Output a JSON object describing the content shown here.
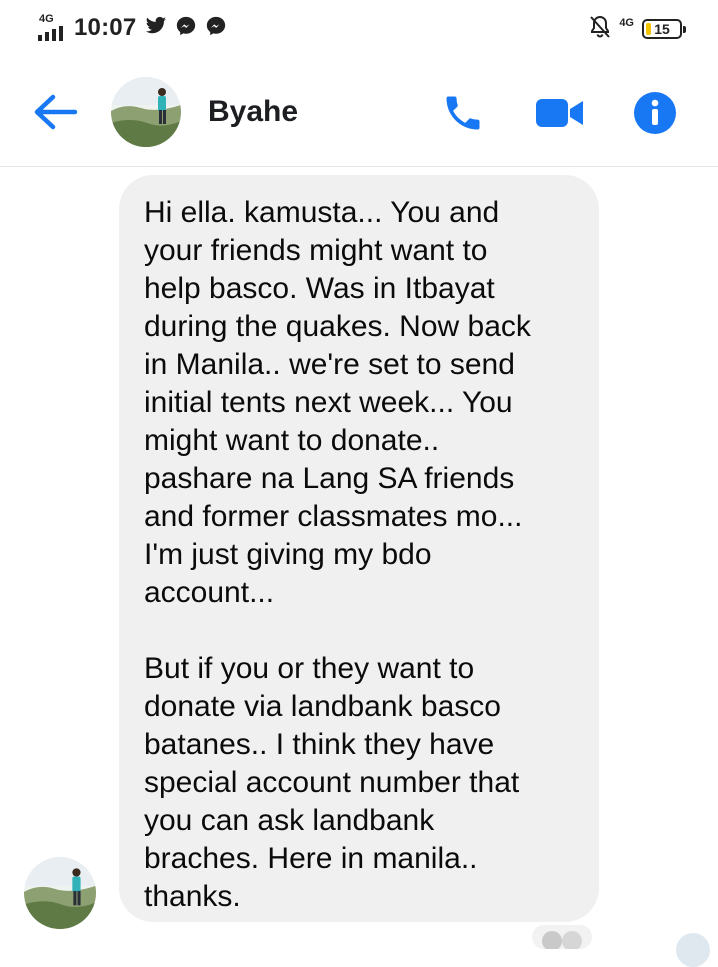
{
  "status_bar": {
    "network_left": "4G",
    "time": "10:07",
    "network_right": "4G",
    "battery_level": "15",
    "battery_fraction": 0.15
  },
  "header": {
    "contact_name": "Byahe"
  },
  "colors": {
    "accent": "#1877f2",
    "bubble": "#f0f0f0",
    "battery_fill": "#f3c400"
  },
  "icons": {
    "back": "arrow-left-icon",
    "call": "phone-icon",
    "video": "video-camera-icon",
    "info": "info-icon",
    "twitter": "twitter-icon",
    "messenger": "messenger-icon",
    "mute": "notification-off-icon"
  },
  "message": {
    "lines": [
      "Hi ella. kamusta... You and",
      "your friends might want to",
      "help basco. Was in Itbayat",
      "during the quakes. Now back",
      "in Manila.. we're set to send",
      "initial tents next week... You",
      "might want to donate..",
      "pashare na Lang SA friends",
      "and former classmates mo...",
      "I'm just giving my bdo",
      "account...",
      "",
      "But if you or they want to",
      "donate via landbank basco",
      "batanes.. I think they have",
      "special account number that",
      "you can ask landbank",
      "braches. Here in manila..",
      "thanks."
    ]
  }
}
